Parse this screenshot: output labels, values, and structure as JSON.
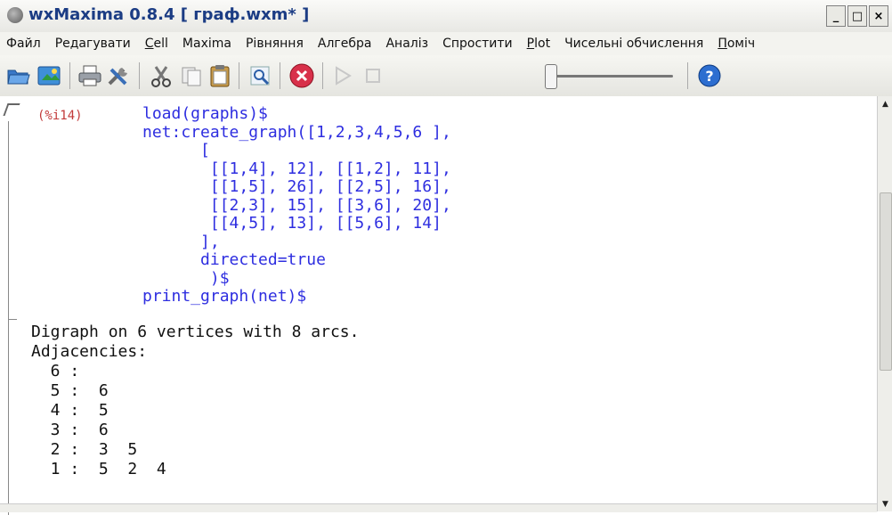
{
  "window": {
    "title": "wxMaxima 0.8.4 [ граф.wxm* ]",
    "buttons": {
      "minimize": "_",
      "maximize": "□",
      "close": "×"
    }
  },
  "menu": [
    "Файл",
    "Редагувати",
    "Cell",
    "Maxima",
    "Рівняння",
    "Алгебра",
    "Аналіз",
    "Спростити",
    "Plot",
    "Чисельні обчислення",
    "Поміч"
  ],
  "toolbar": {
    "icons": [
      "open-icon",
      "save-icon",
      "print-icon",
      "preferences-icon",
      "cut-icon",
      "copy-icon",
      "paste-icon",
      "find-icon",
      "interrupt-icon",
      "play-icon",
      "stop-icon",
      "animation-slider",
      "help-icon"
    ],
    "slider_position": 0.0
  },
  "cell": {
    "label": "(%i14)",
    "code_lines": [
      "load(graphs)$",
      "net:create_graph([1,2,3,4,5,6 ],",
      "      [",
      "       [[1,4], 12], [[1,2], 11],",
      "       [[1,5], 26], [[2,5], 16],",
      "       [[2,3], 15], [[3,6], 20],",
      "       [[4,5], 13], [[5,6], 14]",
      "      ],",
      "      directed=true",
      "       )$",
      "print_graph(net)$"
    ],
    "output_lines": [
      "Digraph on 6 vertices with 8 arcs.",
      "Adjacencies:",
      "  6 :",
      "  5 :  6",
      "  4 :  5",
      "  3 :  6",
      "  2 :  3  5",
      "  1 :  5  2  4"
    ]
  },
  "colors": {
    "code": "#2e2ee0",
    "label": "#c23a3a",
    "title": "#1b3c84",
    "stop": "#d8304a"
  }
}
